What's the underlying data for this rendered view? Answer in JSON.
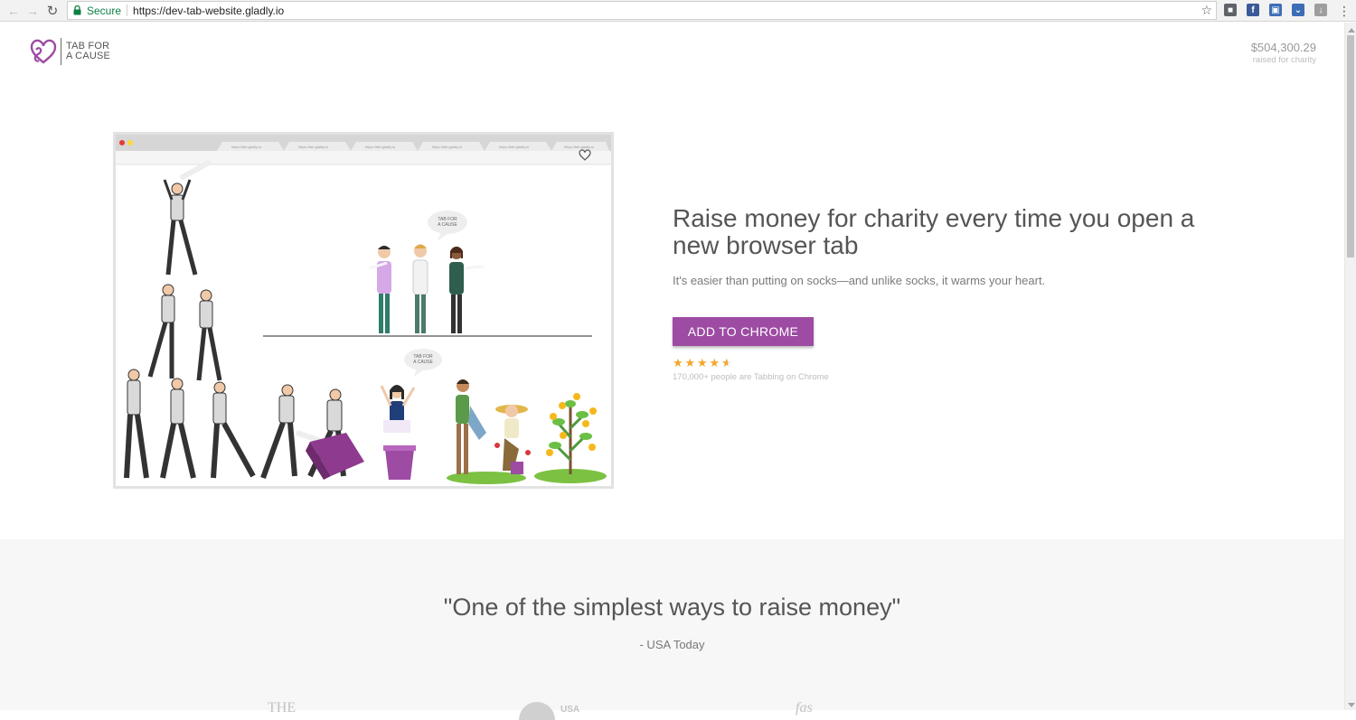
{
  "browser": {
    "secure_label": "Secure",
    "url": "https://dev-tab-website.gladly.io",
    "extensions": [
      {
        "icon": "ghost-extension-icon",
        "color": "#5f6368"
      },
      {
        "icon": "facebook-extension-icon",
        "color": "#3b5998"
      },
      {
        "icon": "screenshot-extension-icon",
        "color": "#3d6db5"
      },
      {
        "icon": "pocket-extension-icon",
        "color": "#3d6db5"
      },
      {
        "icon": "download-extension-icon",
        "color": "#9e9e9e"
      }
    ]
  },
  "header": {
    "logo_line1": "TAB FOR",
    "logo_line2": "A CAUSE",
    "raised_amount": "$504,300.29",
    "raised_label": "raised for charity"
  },
  "hero": {
    "title": "Raise money for charity every time you open a new browser tab",
    "subtitle": "It's easier than putting on socks—and unlike socks, it warms your heart.",
    "cta_label": "ADD TO CHROME",
    "rating_stars": 4.5,
    "rating_text": "170,000+ people are Tabbing on Chrome",
    "illustration": {
      "tab_url_text": "https://tab.gladly.io",
      "bubble_line1": "TAB FOR",
      "bubble_line2": "A CAUSE"
    }
  },
  "quote": {
    "text": "\"One of the simplest ways to raise money\"",
    "source": "- USA Today"
  },
  "press": {
    "logo_1": "THE",
    "logo_2": "USA",
    "logo_3": "fas"
  },
  "colors": {
    "brand_purple": "#9d4ba3",
    "star_gold": "#f2a72a",
    "secure_green": "#0b8043"
  }
}
